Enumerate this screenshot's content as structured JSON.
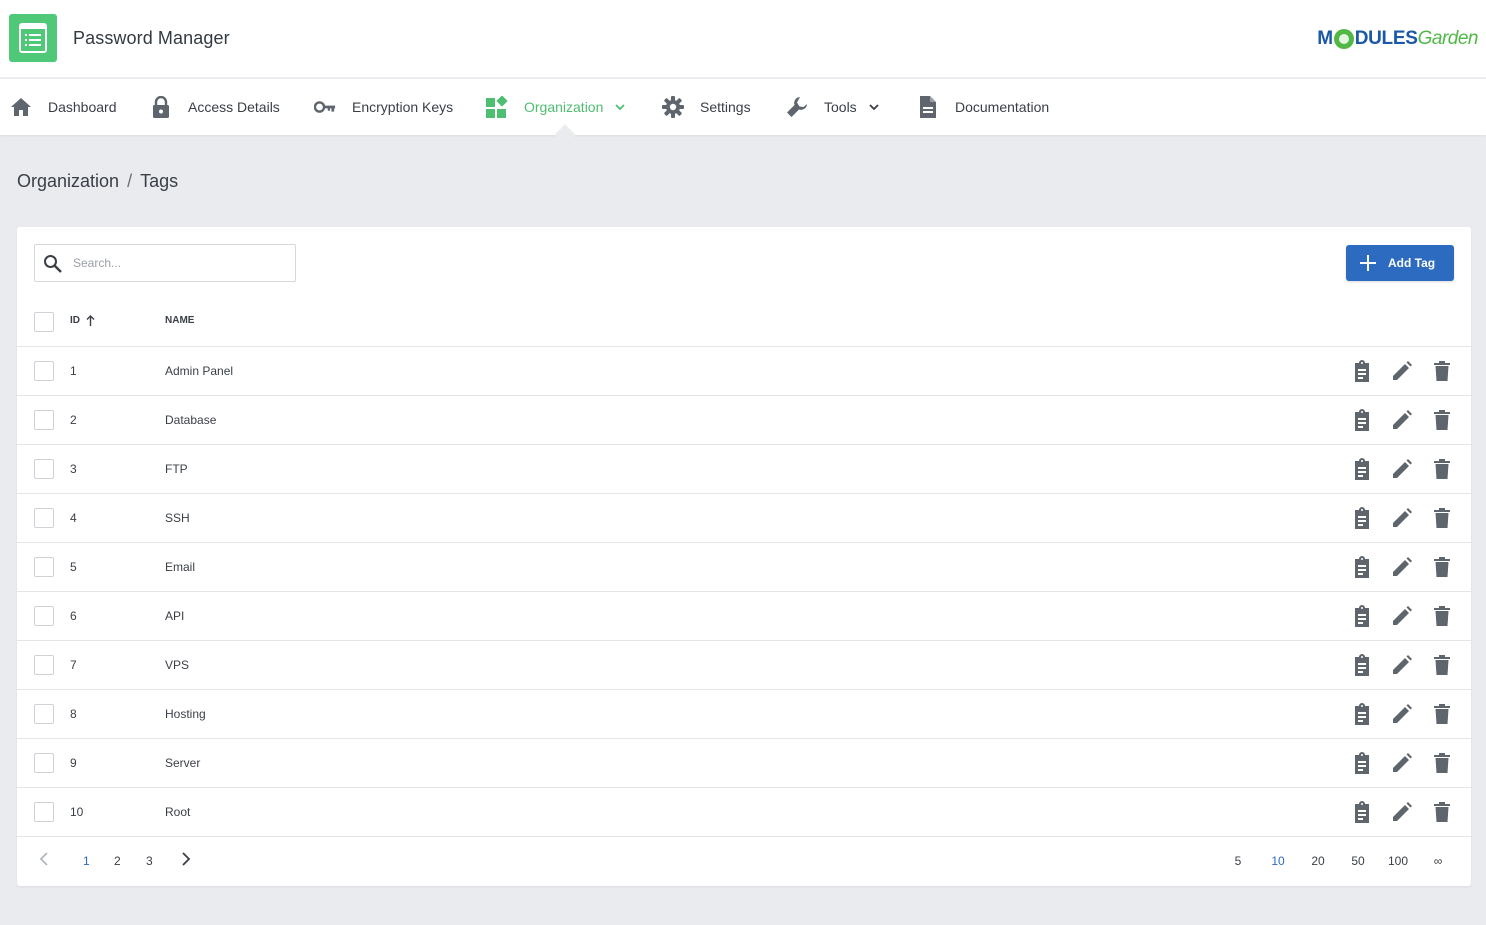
{
  "app": {
    "title": "Password Manager",
    "logo_main": "M",
    "logo_rest": "DULES",
    "logo_garden": "Garden"
  },
  "nav": {
    "items": [
      {
        "label": "Dashboard",
        "icon": "home-icon"
      },
      {
        "label": "Access Details",
        "icon": "lock-icon"
      },
      {
        "label": "Encryption Keys",
        "icon": "key-icon"
      },
      {
        "label": "Organization",
        "icon": "widgets-icon",
        "active": true,
        "dropdown": true
      },
      {
        "label": "Settings",
        "icon": "gear-icon"
      },
      {
        "label": "Tools",
        "icon": "wrench-icon",
        "dropdown": true
      },
      {
        "label": "Documentation",
        "icon": "document-icon"
      }
    ],
    "accent_color": "#4fbd72"
  },
  "breadcrumb": {
    "parent": "Organization",
    "separator": "/",
    "current": "Tags"
  },
  "toolbar": {
    "search_placeholder": "Search...",
    "search_value": "",
    "add_label": "Add Tag",
    "add_color": "#2c6bbf"
  },
  "table": {
    "columns": {
      "id": "ID",
      "name": "NAME"
    },
    "sort": "id ascending",
    "rows": [
      {
        "id": "1",
        "name": "Admin Panel"
      },
      {
        "id": "2",
        "name": "Database"
      },
      {
        "id": "3",
        "name": "FTP"
      },
      {
        "id": "4",
        "name": "SSH"
      },
      {
        "id": "5",
        "name": "Email"
      },
      {
        "id": "6",
        "name": "API"
      },
      {
        "id": "7",
        "name": "VPS"
      },
      {
        "id": "8",
        "name": "Hosting"
      },
      {
        "id": "9",
        "name": "Server"
      },
      {
        "id": "10",
        "name": "Root"
      }
    ],
    "row_actions": [
      "clipboard-icon",
      "pencil-icon",
      "trash-icon"
    ]
  },
  "pagination": {
    "pages": [
      "1",
      "2",
      "3"
    ],
    "current_page": "1",
    "page_sizes": [
      "5",
      "10",
      "20",
      "50",
      "100",
      "∞"
    ],
    "current_size": "10"
  }
}
